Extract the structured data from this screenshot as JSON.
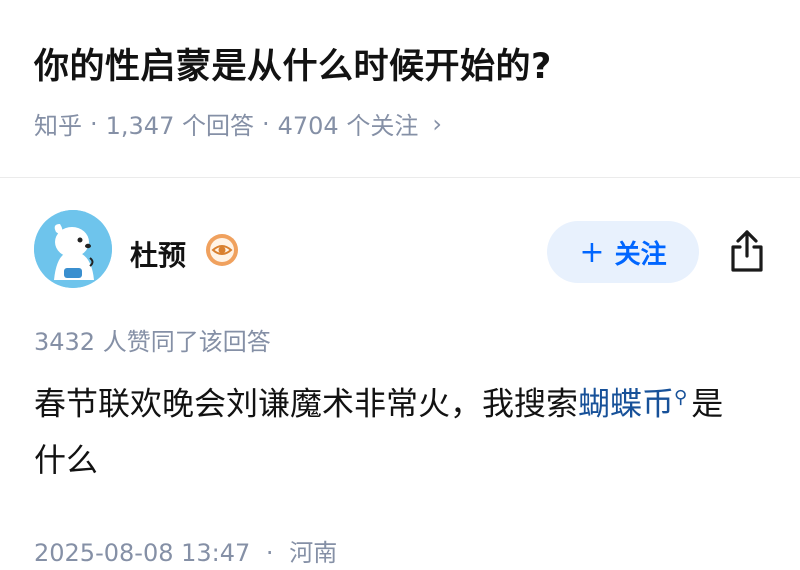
{
  "question": {
    "title": "你的性启蒙是从什么时候开始的?",
    "source": "知乎",
    "answers_count": "1,347 个回答",
    "followers_count": "4704 个关注",
    "chevron": "›"
  },
  "author": {
    "name": "杜预",
    "avatar_icon": "cartoon-dog-avatar",
    "badge_icon": "eye-badge-icon",
    "follow_label": "关注",
    "follow_plus": "+"
  },
  "answer": {
    "upvote_text": "3432 人赞同了该回答",
    "body_prefix": "春节联欢晚会刘谦魔术非常火，我搜索",
    "search_term": "蝴蝶币",
    "body_suffix": "是什么",
    "timestamp": "2025-08-08 13:47",
    "location": "河南"
  },
  "colors": {
    "accent": "#0066ff",
    "follow_bg": "#e8f1fd",
    "meta_gray": "#8590a6",
    "link_blue": "#175199"
  }
}
